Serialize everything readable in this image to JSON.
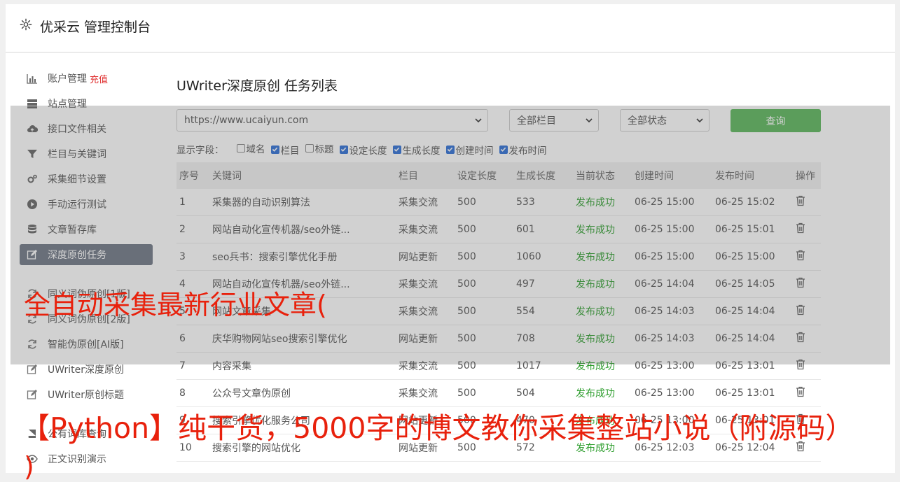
{
  "header": {
    "title": "优采云 管理控制台",
    "icon": "gear-icon"
  },
  "sidebar": {
    "items": [
      {
        "label": "账户管理",
        "extra": "充值",
        "icon": "bar-chart-icon"
      },
      {
        "label": "站点管理",
        "icon": "server-icon"
      },
      {
        "label": "接口文件相关",
        "icon": "cloud-upload-icon"
      },
      {
        "label": "栏目与关键词",
        "icon": "filter-icon"
      },
      {
        "label": "采集细节设置",
        "icon": "cogs-icon"
      },
      {
        "label": "手动运行测试",
        "icon": "play-circle-icon"
      },
      {
        "label": "文章暂存库",
        "icon": "database-icon"
      },
      {
        "label": "深度原创任务",
        "icon": "edit-icon",
        "active": true
      },
      {
        "label": "同义词伪原创[1版]",
        "icon": "refresh-icon"
      },
      {
        "label": "同义词伪原创[2版]",
        "icon": "refresh-icon"
      },
      {
        "label": "智能伪原创[AI版]",
        "icon": "refresh-icon"
      },
      {
        "label": "UWriter深度原创",
        "icon": "edit-icon"
      },
      {
        "label": "UWriter原创标题",
        "icon": "edit-icon"
      },
      {
        "label": "公有词库查询",
        "icon": "book-icon"
      },
      {
        "label": "正文识别演示",
        "icon": "eye-icon"
      }
    ]
  },
  "main": {
    "title": "UWriter深度原创 任务列表",
    "filters": {
      "site": "https://www.ucaiyun.com",
      "column": "全部栏目",
      "status": "全部状态",
      "query_label": "查询"
    },
    "fields": {
      "label": "显示字段：",
      "options": [
        {
          "label": "域名",
          "checked": false
        },
        {
          "label": "栏目",
          "checked": true
        },
        {
          "label": "标题",
          "checked": false
        },
        {
          "label": "设定长度",
          "checked": true
        },
        {
          "label": "生成长度",
          "checked": true
        },
        {
          "label": "创建时间",
          "checked": true
        },
        {
          "label": "发布时间",
          "checked": true
        }
      ]
    },
    "table": {
      "headers": [
        "序号",
        "关键词",
        "栏目",
        "设定长度",
        "生成长度",
        "当前状态",
        "创建时间",
        "发布时间",
        "操作"
      ],
      "rows": [
        [
          "1",
          "采集器的自动识别算法",
          "采集交流",
          "500",
          "533",
          "发布成功",
          "06-25 15:00",
          "06-25 15:02"
        ],
        [
          "2",
          "网站自动化宣传机器/seo外链...",
          "采集交流",
          "500",
          "601",
          "发布成功",
          "06-25 15:00",
          "06-25 15:01"
        ],
        [
          "3",
          "seo兵书：搜索引擎优化手册",
          "网站更新",
          "500",
          "1060",
          "发布成功",
          "06-25 15:00",
          "06-25 15:00"
        ],
        [
          "4",
          "网站自动化宣传机器/seo外链...",
          "采集交流",
          "500",
          "497",
          "发布成功",
          "06-25 14:04",
          "06-25 14:05"
        ],
        [
          "5",
          "网站文章采集",
          "采集交流",
          "500",
          "554",
          "发布成功",
          "06-25 14:03",
          "06-25 14:04"
        ],
        [
          "6",
          "庆华购物网站seo搜索引擎优化",
          "网站更新",
          "500",
          "708",
          "发布成功",
          "06-25 14:03",
          "06-25 14:04"
        ],
        [
          "7",
          "内容采集",
          "采集交流",
          "500",
          "1017",
          "发布成功",
          "06-25 13:00",
          "06-25 13:01"
        ],
        [
          "8",
          "公众号文章伪原创",
          "采集交流",
          "500",
          "504",
          "发布成功",
          "06-25 13:00",
          "06-25 13:01"
        ],
        [
          "9",
          "搜索引擎优化服务公司",
          "网站更新",
          "500",
          "470",
          "发布成功",
          "06-25 13:00",
          "06-25 13:01"
        ],
        [
          "10",
          "搜索引擎的网站优化",
          "网站更新",
          "500",
          "572",
          "发布成功",
          "06-25 12:03",
          "06-25 12:04"
        ]
      ]
    }
  },
  "overlay": {
    "line1": "全自动采集最新行业文章(",
    "line2": "【Python】纯干货，5000字的博文教你采集整站小说（附源码）",
    "line3": ")",
    "color": "#e8210c"
  }
}
